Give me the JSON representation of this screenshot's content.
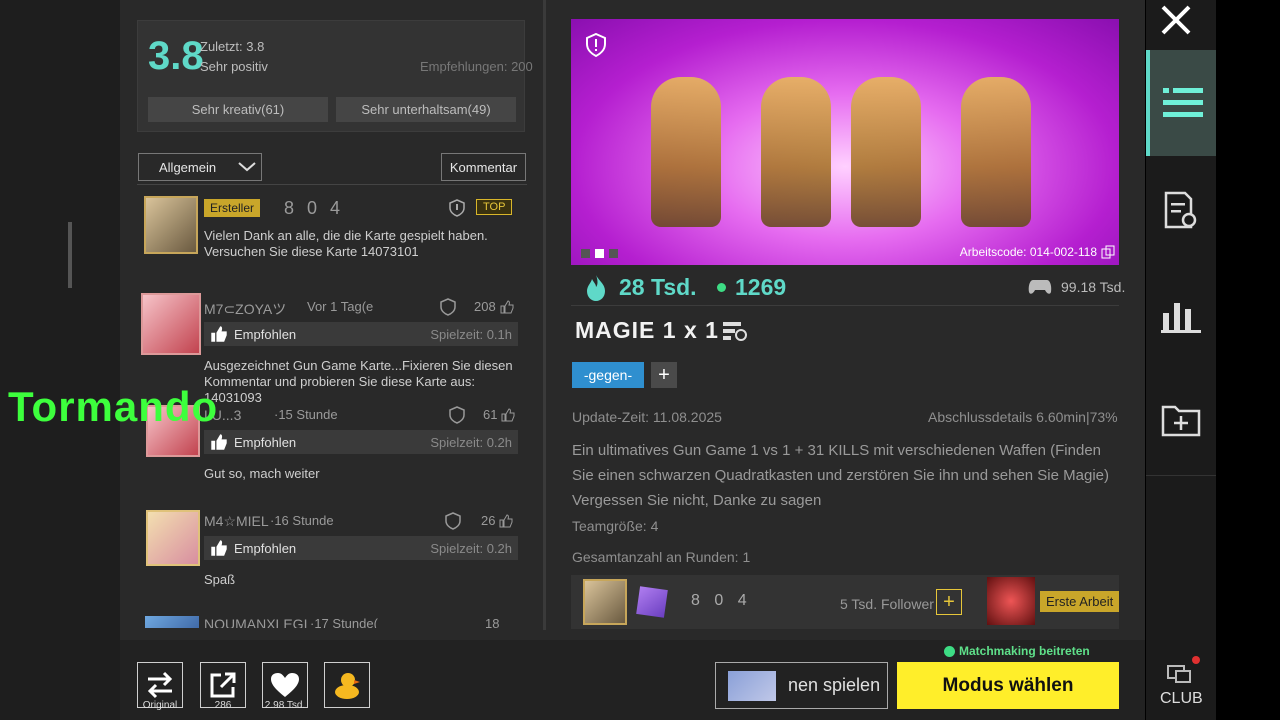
{
  "rating": {
    "score": "3.8",
    "last_label": "Zuletzt: 3.8",
    "sentiment": "Sehr positiv",
    "recommendations": "Empfehlungen: 200",
    "tag1": "Sehr kreativ(61)",
    "tag2": "Sehr unterhaltsam(49)"
  },
  "filters": {
    "dropdown_value": "Allgemein",
    "comment_button": "Kommentar"
  },
  "comments": [
    {
      "badge": "Ersteller",
      "name": "8 0 4",
      "flag": "TOP",
      "text": "Vielen Dank an alle, die die Karte gespielt haben. Versuchen Sie diese Karte 14073101"
    },
    {
      "name": "M7⊂ZOYAツ",
      "time": "Vor 1 Tag(e",
      "likes": "208",
      "rec": "Empfohlen",
      "playtime": "Spielzeit: 0.1h",
      "text": "Ausgezeichnet Gun Game Karte...Fixieren Sie diesen Kommentar und probieren Sie diese Karte aus: 14031093"
    },
    {
      "name": "LU...3",
      "time": "·15 Stunde",
      "likes": "61",
      "rec": "Empfohlen",
      "playtime": "Spielzeit: 0.2h",
      "text": "Gut so, mach weiter"
    },
    {
      "name": "M4☆MIEL",
      "time": "·16 Stunde",
      "likes": "26",
      "rec": "Empfohlen",
      "playtime": "Spielzeit: 0.2h",
      "text": "Spaß"
    },
    {
      "name": "NOUMANXLEGI",
      "time": "·17 Stunde(",
      "likes": "18"
    }
  ],
  "overlay": {
    "text": "Tormando"
  },
  "map": {
    "work_code": "Arbeitscode: 014-002-118",
    "hot": "28 Tsd.",
    "online": "1269",
    "plays": "99.18 Tsd.",
    "title": "MAGIE  1 x 1",
    "tag": "-gegen-",
    "tag_add": "+",
    "update_time": "Update-Zeit: 11.08.2025",
    "completion": "Abschlussdetails  6.60min|73%",
    "description": "Ein ultimatives Gun Game 1 vs 1 + 31 KILLS mit verschiedenen Waffen (Finden Sie einen schwarzen Quadratkasten und zerstören Sie ihn und sehen Sie Magie) Vergessen Sie nicht, Danke zu sagen",
    "team_size": "Teamgröße: 4",
    "rounds": "Gesamtanzahl an Runden: 1"
  },
  "creator": {
    "name": "8 0 4",
    "followers": "5 Tsd. Follower",
    "follow": "+",
    "badge": "Erste Arbeit"
  },
  "bottom": {
    "original_label": "Original",
    "share_count": "286",
    "likes_count": "2.98 Tsd.",
    "play_label": "nen spielen",
    "matchmaking": "Matchmaking beitreten",
    "mode_button": "Modus wählen",
    "club_label": "CLUB"
  },
  "colors": {
    "accent": "#5fd9c8",
    "yellow": "#ffee2a",
    "hero": "#d24be6"
  }
}
